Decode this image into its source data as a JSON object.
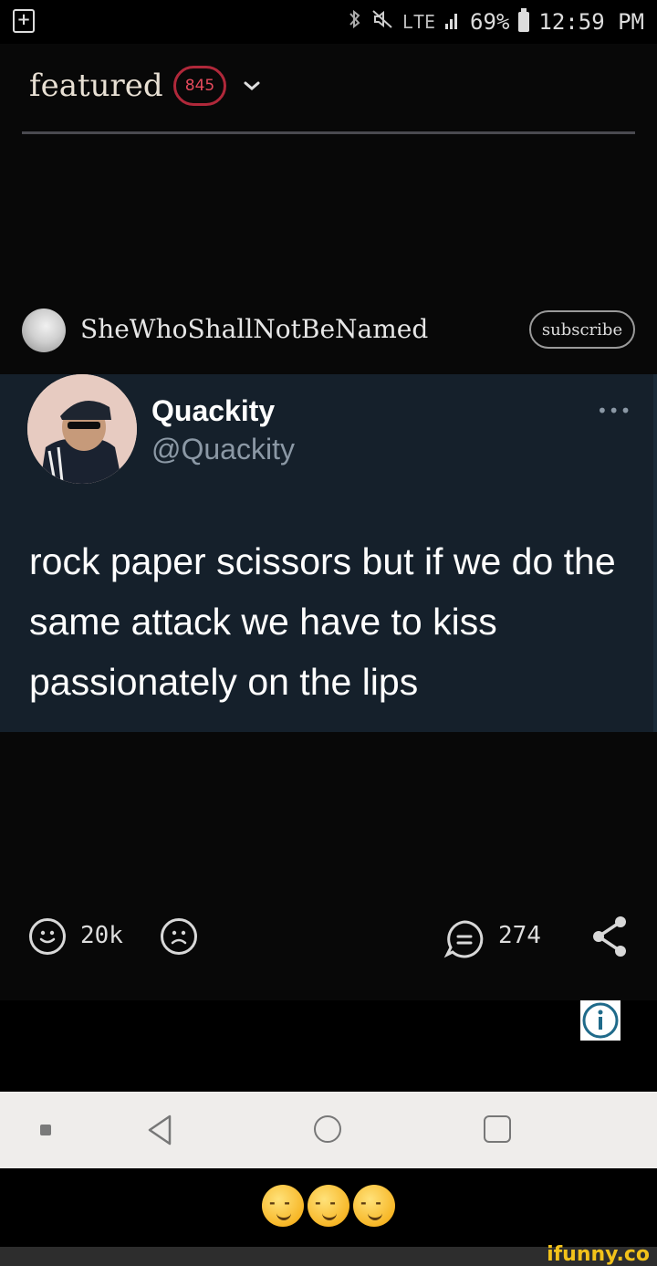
{
  "status_bar": {
    "network": "LTE",
    "battery": "69%",
    "time": "12:59 PM"
  },
  "header": {
    "title": "featured",
    "badge_count": "845"
  },
  "post": {
    "author": "SheWhoShallNotBeNamed",
    "subscribe_label": "subscribe",
    "tweet": {
      "name": "Quackity",
      "handle": "@Quackity",
      "text": "rock paper scissors but if we do the same attack we have to kiss passionately on the lips"
    },
    "smiles": "20k",
    "comments": "274"
  },
  "colors": {
    "badge_border": "#b0283a",
    "tweet_bg": "#15202b",
    "nav_bg": "#efedeb",
    "watermark": "#f2c21a"
  },
  "caption": {
    "emoji_name": "smirking-face",
    "emoji_count": 3
  },
  "watermark": "ifunny.co"
}
